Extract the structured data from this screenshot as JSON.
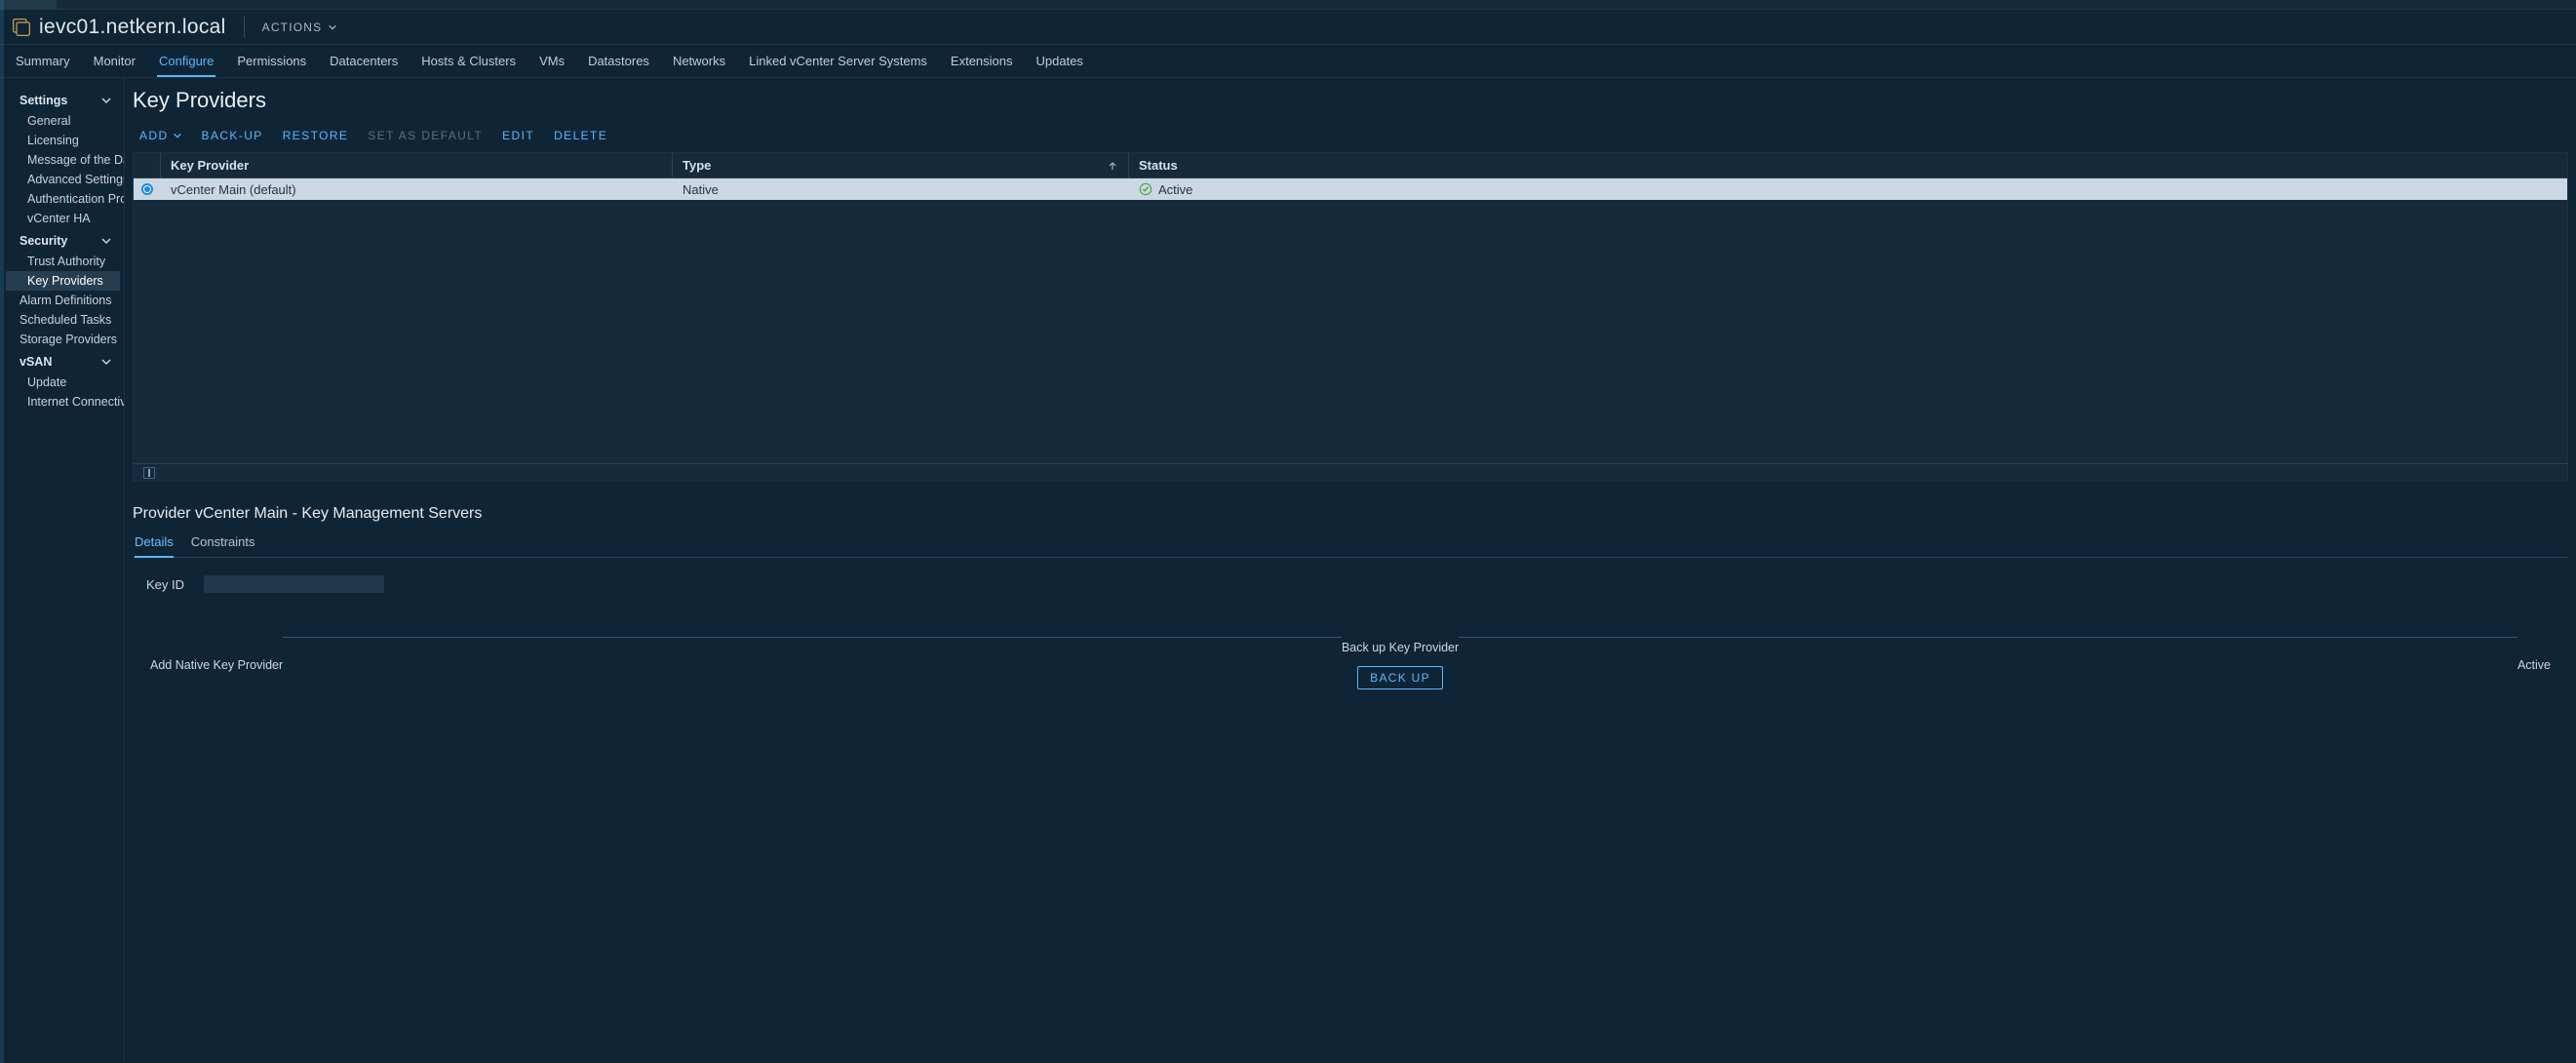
{
  "colors": {
    "accent": "#59b7ff",
    "success": "#8ac44d"
  },
  "header": {
    "vc_name": "ievc01.netkern.local",
    "actions_label": "Actions"
  },
  "tabs": [
    "Summary",
    "Monitor",
    "Configure",
    "Permissions",
    "Datacenters",
    "Hosts & Clusters",
    "VMs",
    "Datastores",
    "Networks",
    "Linked vCenter Server Systems",
    "Extensions",
    "Updates"
  ],
  "active_tab_index": 2,
  "sidebar": {
    "groups": [
      {
        "label": "Settings",
        "items": [
          "General",
          "Licensing",
          "Message of the Day",
          "Advanced Settings",
          "Authentication Proxy",
          "vCenter HA"
        ]
      },
      {
        "label": "Security",
        "items": [
          "Trust Authority",
          "Key Providers"
        ],
        "selected_index": 1
      }
    ],
    "toplevel": [
      "Alarm Definitions",
      "Scheduled Tasks",
      "Storage Providers"
    ],
    "groups2": [
      {
        "label": "vSAN",
        "items": [
          "Update",
          "Internet Connectivity"
        ]
      }
    ]
  },
  "page": {
    "title": "Key Providers"
  },
  "action_bar": {
    "add": "Add",
    "backup": "Back-up",
    "restore": "Restore",
    "set_default": "Set as Default",
    "edit": "Edit",
    "delete": "Delete",
    "disabled": [
      "set_default"
    ]
  },
  "table": {
    "headers": {
      "key_provider": "Key Provider",
      "type": "Type",
      "status": "Status"
    },
    "sort_column": "type",
    "rows": [
      {
        "name": "vCenter Main (default)",
        "type": "Native",
        "status": "Active",
        "selected": true
      }
    ]
  },
  "details": {
    "title": "Provider vCenter Main - Key Management Servers",
    "subtabs": [
      "Details",
      "Constraints"
    ],
    "active_subtab_index": 0,
    "key_id": {
      "label": "Key ID",
      "value_masked": true
    },
    "stepper": {
      "steps": [
        {
          "label": "Add Native Key Provider",
          "done": true
        },
        {
          "label": "Back up Key Provider",
          "done": true,
          "button": "Back up"
        },
        {
          "label": "Active",
          "done": true
        }
      ]
    }
  }
}
